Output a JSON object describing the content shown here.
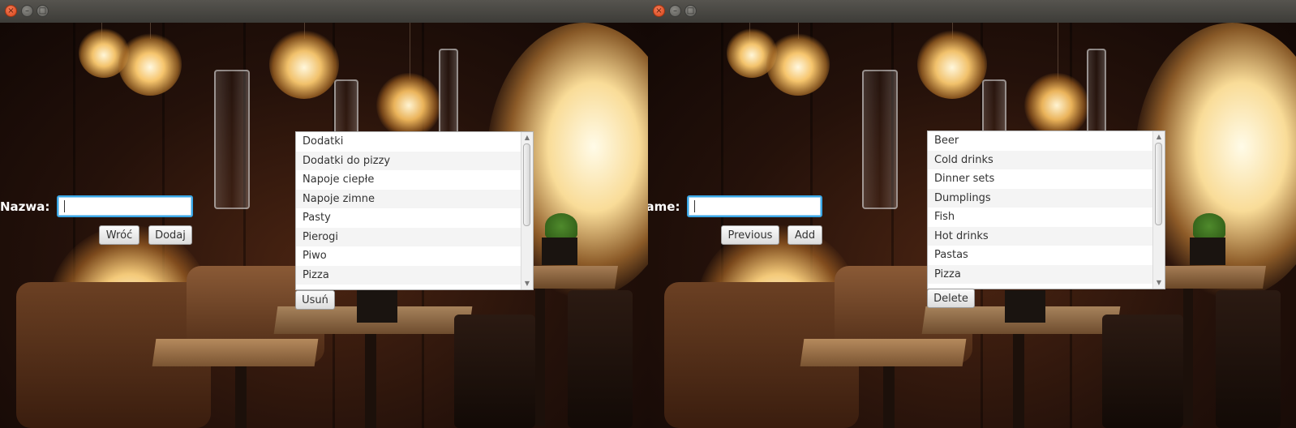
{
  "left_window": {
    "title_buttons": {
      "close_icon": "close-icon",
      "minimize_icon": "minimize-icon",
      "maximize_icon": "maximize-icon"
    },
    "name_label": "Nazwa:",
    "name_value": "",
    "back_label": "Wróć",
    "add_label": "Dodaj",
    "delete_label": "Usuń",
    "categories": [
      "Dodatki",
      "Dodatki do pizzy",
      "Napoje ciepłe",
      "Napoje zimne",
      "Pasty",
      "Pierogi",
      "Piwo",
      "Pizza"
    ]
  },
  "right_window": {
    "title_buttons": {
      "close_icon": "close-icon",
      "minimize_icon": "minimize-icon",
      "maximize_icon": "maximize-icon"
    },
    "name_label": "Name:",
    "name_value": "",
    "previous_label": "Previous",
    "add_label": "Add",
    "delete_label": "Delete",
    "categories": [
      "Beer",
      "Cold drinks",
      "Dinner sets",
      "Dumplings",
      "Fish",
      "Hot drinks",
      "Pastas",
      "Pizza"
    ]
  },
  "colors": {
    "focus_border": "#3aa7e6",
    "close_button": "#e05a2b",
    "titlebar": "#3d3c38"
  }
}
